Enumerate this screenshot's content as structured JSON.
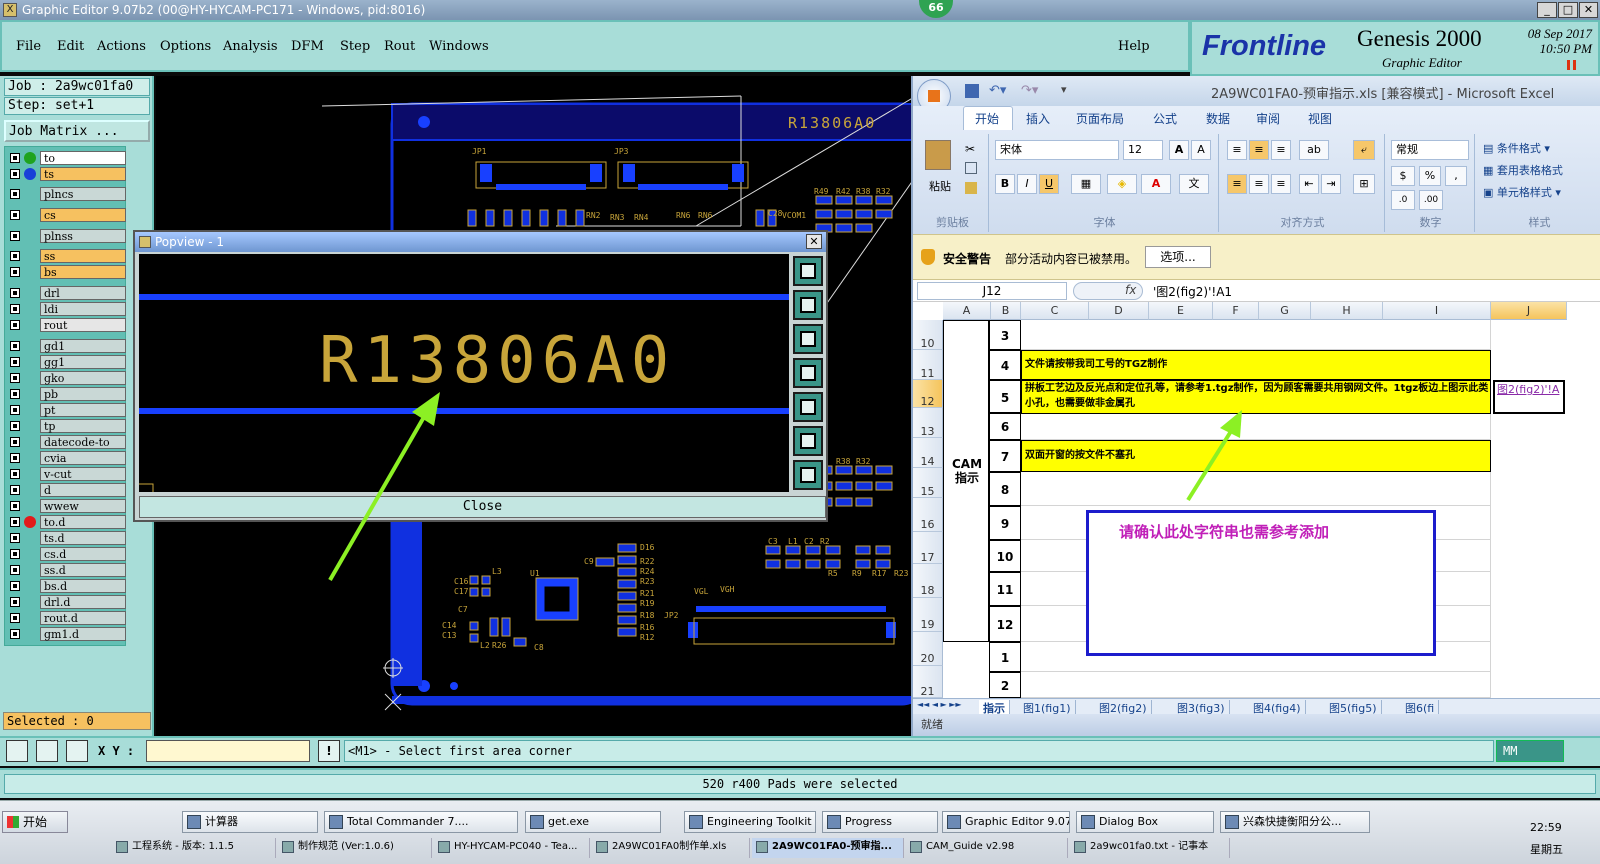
{
  "window": {
    "title": "Graphic Editor 9.07b2 (00@HY-HYCAM-PC171 - Windows, pid:8016)",
    "badge": "66"
  },
  "menu": [
    "File",
    "Edit",
    "Actions",
    "Options",
    "Analysis",
    "DFM",
    "Step",
    "Rout",
    "Windows"
  ],
  "help": "Help",
  "brand": {
    "logo": "Frontline",
    "product": "Genesis 2000",
    "subtitle": "Graphic Editor",
    "date": "08 Sep 2017",
    "time": "10:50 PM"
  },
  "job": {
    "job": "Job : 2a9wc01fa0",
    "step": "Step: set+1",
    "matrix": "Job Matrix ..."
  },
  "layers": [
    {
      "name": "to",
      "color": "#ffffff",
      "dot": "#1fa31f"
    },
    {
      "name": "ts",
      "color": "#f6c160",
      "dot": "#1840d8"
    },
    {
      "name": "plncs",
      "color": "#c9d8d6",
      "dot": ""
    },
    {
      "name": "cs",
      "color": "#f6c160",
      "dot": ""
    },
    {
      "name": "plnss",
      "color": "#c9d8d6",
      "dot": ""
    },
    {
      "name": "ss",
      "color": "#f6c160",
      "dot": ""
    },
    {
      "name": "bs",
      "color": "#f6c160",
      "dot": ""
    },
    {
      "name": "drl",
      "color": "#c9d8d6",
      "dot": ""
    },
    {
      "name": "ldi",
      "color": "#c9d8d6",
      "dot": ""
    },
    {
      "name": "rout",
      "color": "#e6e6e6",
      "dot": ""
    },
    {
      "name": "gd1",
      "color": "#c9d8d6",
      "dot": ""
    },
    {
      "name": "gg1",
      "color": "#c9d8d6",
      "dot": ""
    },
    {
      "name": "gko",
      "color": "#c9d8d6",
      "dot": ""
    },
    {
      "name": "pb",
      "color": "#c9d8d6",
      "dot": ""
    },
    {
      "name": "pt",
      "color": "#c9d8d6",
      "dot": ""
    },
    {
      "name": "tp",
      "color": "#c9d8d6",
      "dot": ""
    },
    {
      "name": "datecode-to",
      "color": "#c9d8d6",
      "dot": ""
    },
    {
      "name": "cvia",
      "color": "#c9d8d6",
      "dot": ""
    },
    {
      "name": "v-cut",
      "color": "#c9d8d6",
      "dot": ""
    },
    {
      "name": "d",
      "color": "#c9d8d6",
      "dot": ""
    },
    {
      "name": "wwew",
      "color": "#c9d8d6",
      "dot": ""
    },
    {
      "name": "to.d",
      "color": "#c9d8d6",
      "dot": "#e21b1b"
    },
    {
      "name": "ts.d",
      "color": "#c9d8d6",
      "dot": ""
    },
    {
      "name": "cs.d",
      "color": "#c9d8d6",
      "dot": ""
    },
    {
      "name": "ss.d",
      "color": "#c9d8d6",
      "dot": ""
    },
    {
      "name": "bs.d",
      "color": "#c9d8d6",
      "dot": ""
    },
    {
      "name": "drl.d",
      "color": "#c9d8d6",
      "dot": ""
    },
    {
      "name": "rout.d",
      "color": "#c9d8d6",
      "dot": ""
    },
    {
      "name": "gm1.d",
      "color": "#c9d8d6",
      "dot": ""
    }
  ],
  "selected": "Selected : 0",
  "board": {
    "string": "R13806A0",
    "labels": [
      "JP1",
      "JP3",
      "RN2",
      "RN3",
      "RN4",
      "RN6",
      "RN6",
      "VCOM1",
      "R49",
      "R42",
      "R38",
      "R32",
      "C28",
      "V13",
      "V12",
      "V11",
      "R42",
      "R38",
      "R32",
      "C3",
      "L1",
      "C2",
      "R2",
      "R5",
      "R9",
      "R17",
      "R23",
      "D16",
      "R22",
      "R24",
      "R23",
      "R21",
      "R19",
      "R18",
      "JP2",
      "R16",
      "R12",
      "C9",
      "U1",
      "L3",
      "C16",
      "C17",
      "C7",
      "C14",
      "C13",
      "L2",
      "R26",
      "C8",
      "VGL",
      "VGH"
    ]
  },
  "popview": {
    "title": "Popview - 1",
    "text": "R13806A0",
    "close": "Close"
  },
  "excel": {
    "title": "2A9WC01FA0-预审指示.xls  [兼容模式] - Microsoft Excel",
    "tabs": [
      "开始",
      "插入",
      "页面布局",
      "公式",
      "数据",
      "审阅",
      "视图"
    ],
    "groups": {
      "clipboard": "剪贴板",
      "font": "字体",
      "align": "对齐方式",
      "number": "数字",
      "style": "样式"
    },
    "paste": "粘贴",
    "font_name": "宋体",
    "font_size": "12",
    "number_fmt": "常规",
    "styles": [
      "条件格式",
      "套用表格格式",
      "单元格样式"
    ],
    "security": {
      "label": "安全警告",
      "msg": "部分活动内容已被禁用。",
      "btn": "选项..."
    },
    "namebox": "J12",
    "formula": "'图2(fig2)'!A1",
    "fx": "fx",
    "cols": [
      "A",
      "B",
      "C",
      "D",
      "E",
      "F",
      "G",
      "H",
      "I",
      "J"
    ],
    "rows": [
      "10",
      "11",
      "12",
      "13",
      "14",
      "15",
      "16",
      "17",
      "18",
      "19",
      "20",
      "21"
    ],
    "section": "CAM 指示",
    "bnums": [
      "3",
      "4",
      "5",
      "6",
      "7",
      "8",
      "9",
      "10",
      "11",
      "12",
      "1",
      "2"
    ],
    "text4": "文件请按带我司工号的TGZ制作",
    "text5": "拼板工艺边及反光点和定位孔等，请参考1.tgz制作，因为顾客需要共用钢网文件。1tgz板边上图示此类小孔，也需要做非金属孔",
    "text7": "双面开窗的按文件不塞孔",
    "jcell": "图2(fig2)'!A",
    "annotation": "请确认此处字符串也需参考添加",
    "sheets": [
      "指示",
      "图1(fig1)",
      "图2(fig2)",
      "图3(fig3)",
      "图4(fig4)",
      "图5(fig5)",
      "图6(fi"
    ],
    "status": "就绪"
  },
  "bottom": {
    "xy_label": "X Y :",
    "prompt": "<M1> - Select first area corner",
    "units": "MM"
  },
  "status_msg": "520 r400 Pads were selected",
  "taskbar": {
    "start": "开始",
    "row1": [
      "计算器",
      "Total Commander 7....",
      "get.exe",
      "Engineering Toolkit 9...",
      "Progress",
      "Graphic Editor 9.07b...",
      "Dialog Box",
      "兴森快捷衡阳分公..."
    ],
    "row2": [
      "工程系统 - 版本: 1.1.5",
      "制作规范 (Ver:1.0.6)",
      "HY-HYCAM-PC040 - Tea...",
      "2A9WC01FA0制作单.xls",
      "2A9WC01FA0-预审指...",
      "CAM_Guide v2.98",
      "2a9wc01fa0.txt - 记事本"
    ],
    "clock": "22:59",
    "day": "星期五"
  }
}
